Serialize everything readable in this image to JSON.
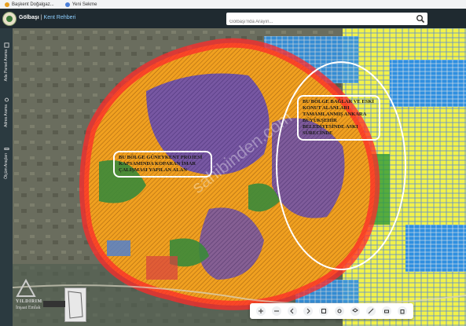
{
  "bookmarks": [
    {
      "label": "Başkent Doğalgaz...",
      "color": "#e8a020"
    },
    {
      "label": "Yeni Sekme",
      "color": "#4a7fd8"
    }
  ],
  "app": {
    "title": "Gölbaşı",
    "subtitle": "Kent Rehberi",
    "search_placeholder": "Gölbaşı'nda Arayın..."
  },
  "sidebar": {
    "items": [
      {
        "label": "Ada Parsel Arama",
        "icon": "parcel-icon"
      },
      {
        "label": "Adres Arama",
        "icon": "address-icon"
      },
      {
        "label": "Ölçüm Araçları",
        "icon": "ruler-icon"
      }
    ]
  },
  "map": {
    "notes": [
      {
        "text": "BU BÖLGE GÜNEYKENT PROJESİ KAPSAMINDA KOPARAN İMAR ÇALIŞMASI YAPILAN ALAN"
      },
      {
        "text": "BU BÖLGE BAĞLAR ve ESKİ KONUT ALANLARI TAMAMLANMIŞ ANKARA BÜYÜKŞEHİR BELEDİYESİNDE ASKI SÜRECİNDE"
      }
    ],
    "watermark": "sahibinden.com"
  },
  "branding": {
    "name": "YILDIRIM",
    "subline": "İnşaat Emlak"
  },
  "toolbar": {
    "tools": [
      "zoom-in-icon",
      "zoom-out-icon",
      "back-icon",
      "forward-icon",
      "fullscreen-icon",
      "location-icon",
      "layers-icon",
      "measure-icon",
      "print-icon",
      "trash-icon"
    ]
  },
  "colors": {
    "zone_orange": "#f0a020",
    "zone_purple": "#6a4fb0",
    "zone_green": "#3a8a3a",
    "zone_yellow": "#f2f24a",
    "zone_blue": "#2f8fe0",
    "boundary_red": "#ff2a2a"
  }
}
